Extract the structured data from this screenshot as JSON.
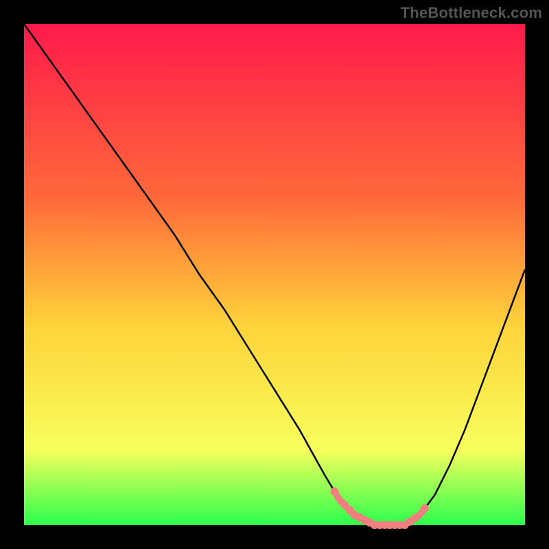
{
  "watermark": "TheBottleneck.com",
  "colors": {
    "background": "#000000",
    "curve": "#000000",
    "highlight": "#f08080",
    "gradient_top": "#ff1a4b",
    "gradient_upper_mid": "#ff6a3a",
    "gradient_mid": "#ffd23a",
    "gradient_lower_mid": "#f7ff5c",
    "gradient_bottom": "#2cff4c"
  },
  "chart_data": {
    "type": "line",
    "title": "",
    "xlabel": "",
    "ylabel": "",
    "xlim": [
      0,
      100
    ],
    "ylim": [
      0,
      100
    ],
    "x": [
      0,
      5,
      10,
      15,
      20,
      25,
      30,
      35,
      40,
      45,
      50,
      55,
      60,
      63,
      66,
      70,
      73,
      76,
      79,
      82,
      85,
      88,
      91,
      94,
      97,
      100
    ],
    "values": [
      100,
      93,
      86,
      79,
      72,
      65,
      58,
      50,
      43,
      35,
      27,
      19,
      10,
      5,
      2,
      0,
      0,
      0,
      2,
      6,
      12,
      19,
      27,
      35,
      43,
      51
    ],
    "highlight_region": {
      "x_start": 62,
      "x_end": 80
    },
    "highlight_points_x": [
      62,
      64,
      65,
      66,
      67,
      68,
      69,
      70,
      71,
      72,
      73,
      74,
      75,
      76,
      77,
      78,
      80
    ]
  }
}
